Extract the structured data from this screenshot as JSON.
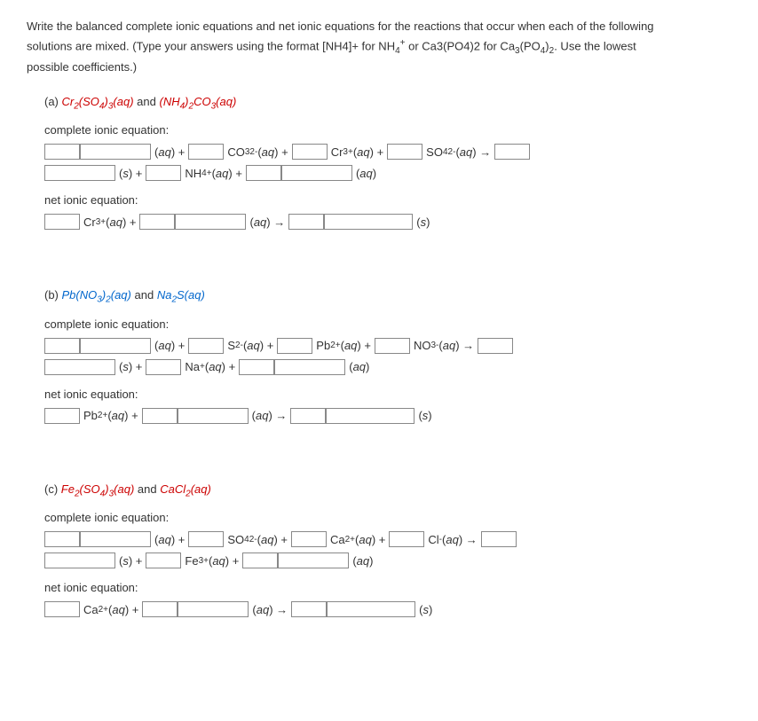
{
  "instructions": {
    "line1": "Write the balanced complete ionic equations and net ionic equations for the reactions that occur when each of the following",
    "line2_pre": "solutions are mixed. (Type your answers using the format [NH4]+ for NH",
    "line2_mid": " or Ca3(PO4)2 for Ca",
    "line2_post": ". Use the lowest",
    "line3": "possible coefficients.)"
  },
  "parts": {
    "a": {
      "letter": "(a)",
      "comp1": "Cr₂(SO₄)₃(aq)",
      "and": "and",
      "comp2": "(NH₄)₂CO₃(aq)",
      "complete_label": "complete ionic equation:",
      "net_label": "net ionic equation:",
      "complete": {
        "co3": "CO₃²⁻(aq) +",
        "cr3": "Cr³⁺(aq) +",
        "so4": "SO₄²⁻(aq) →",
        "aq_plus": "(aq) +",
        "s_plus": "(s) +",
        "nh4": "NH₄⁺(aq) +",
        "aq": "(aq)"
      },
      "net": {
        "cr3": "Cr³⁺(aq) +",
        "aq_arrow": "(aq) →",
        "s": "(s)"
      }
    },
    "b": {
      "letter": "(b)",
      "comp1": "Pb(NO₃)₂(aq)",
      "and": "and",
      "comp2": "Na₂S(aq)",
      "complete_label": "complete ionic equation:",
      "net_label": "net ionic equation:",
      "complete": {
        "s2": "S²⁻(aq) +",
        "pb2": "Pb²⁺(aq) +",
        "no3": "NO₃⁻(aq) →",
        "aq_plus": "(aq) +",
        "s_plus": "(s) +",
        "na": "Na⁺(aq) +",
        "aq": "(aq)"
      },
      "net": {
        "pb2": "Pb²⁺(aq) +",
        "aq_arrow": "(aq) →",
        "s": "(s)"
      }
    },
    "c": {
      "letter": "(c)",
      "comp1": "Fe₂(SO₄)₃(aq)",
      "and": "and",
      "comp2": "CaCl₂(aq)",
      "complete_label": "complete ionic equation:",
      "net_label": "net ionic equation:",
      "complete": {
        "so4": "SO₄²⁻(aq) +",
        "ca2": "Ca²⁺(aq) +",
        "cl": "Cl⁻(aq) →",
        "aq_plus": "(aq) +",
        "s_plus": "(s) +",
        "fe3": "Fe³⁺(aq) +",
        "aq": "(aq)"
      },
      "net": {
        "ca2": "Ca²⁺(aq) +",
        "aq_arrow": "(aq) →",
        "s": "(s)"
      }
    }
  }
}
